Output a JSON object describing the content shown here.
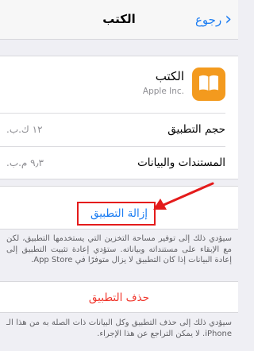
{
  "nav": {
    "title": "الكتب",
    "back_label": "رجوع"
  },
  "app": {
    "name": "الكتب",
    "developer": "Apple Inc.",
    "icon_color": "#f39a1e"
  },
  "rows": [
    {
      "label": "حجم التطبيق",
      "value": "١٢ ك.ب."
    },
    {
      "label": "المستندات والبيانات",
      "value": "٩٫٣ م.ب."
    }
  ],
  "offload": {
    "label": "إزالة التطبيق",
    "footnote": "سيؤدي ذلك إلى توفير مساحة التخزين التي يستخدمها التطبيق، لكن مع الإبقاء على مستنداته وبياناته. ستؤدي إعادة تثبيت التطبيق إلى إعادة البيانات إذا كان التطبيق لا يزال متوفرًا في App Store."
  },
  "delete": {
    "label": "حذف التطبيق",
    "footnote": "سيؤدي ذلك إلى حذف التطبيق وكل البيانات ذات الصلة به من هذا الـ iPhone. لا يمكن التراجع عن هذا الإجراء."
  },
  "colors": {
    "accent": "#1a7cf2",
    "destructive": "#f0362c",
    "annotation": "#e41b1b"
  }
}
